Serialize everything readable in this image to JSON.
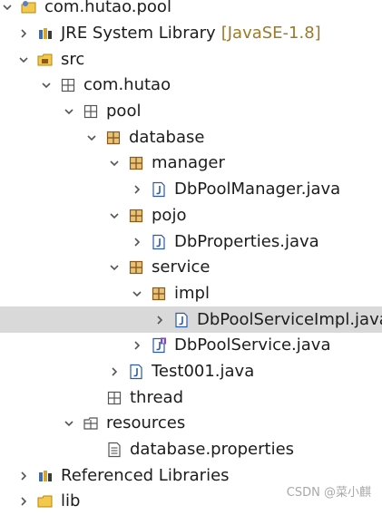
{
  "explorer": {
    "project": {
      "label": "com.hutao.pool"
    },
    "jre": {
      "label": "JRE System Library",
      "decoration": "[JavaSE-1.8]"
    },
    "src": {
      "label": "src"
    },
    "pkg_com_hutao": {
      "label": "com.hutao"
    },
    "pkg_pool": {
      "label": "pool"
    },
    "pkg_database": {
      "label": "database"
    },
    "pkg_manager": {
      "label": "manager"
    },
    "file_dbpoolmanager": {
      "label": "DbPoolManager.java"
    },
    "pkg_pojo": {
      "label": "pojo"
    },
    "file_dbproperties": {
      "label": "DbProperties.java"
    },
    "pkg_service": {
      "label": "service"
    },
    "pkg_impl": {
      "label": "impl"
    },
    "file_dbpoolserviceimpl": {
      "label": "DbPoolServiceImpl.java"
    },
    "file_dbpoolservice": {
      "label": "DbPoolService.java"
    },
    "file_test001": {
      "label": "Test001.java"
    },
    "pkg_thread": {
      "label": "thread"
    },
    "resources": {
      "label": "resources"
    },
    "file_database_properties": {
      "label": "database.properties"
    },
    "referenced_libraries": {
      "label": "Referenced Libraries"
    },
    "lib": {
      "label": "lib"
    }
  },
  "watermark": {
    "text": "CSDN @菜小麒"
  },
  "colors": {
    "selection": "#d9d9d9",
    "package_icon": "#8a5a1a",
    "decoration": "#9a7a2a",
    "java_file_icon": "#2a5aa8"
  }
}
